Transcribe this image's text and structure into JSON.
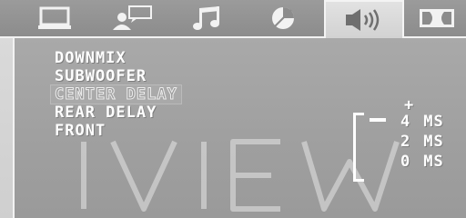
{
  "tabs": [
    {
      "id": "display",
      "icon": "monitor-icon"
    },
    {
      "id": "language",
      "icon": "person-speech-icon"
    },
    {
      "id": "audio",
      "icon": "music-notes-icon"
    },
    {
      "id": "video",
      "icon": "color-disc-icon"
    },
    {
      "id": "speaker",
      "icon": "speaker-icon",
      "active": true
    },
    {
      "id": "dolby",
      "icon": "dolby-icon"
    }
  ],
  "menu": {
    "items": [
      {
        "label": "DOWNMIX",
        "selected": false
      },
      {
        "label": "SUBWOOFER",
        "selected": false
      },
      {
        "label": "CENTER DELAY",
        "selected": true
      },
      {
        "label": "REAR DELAY",
        "selected": false
      },
      {
        "label": "FRONT",
        "selected": false
      }
    ]
  },
  "delay_scale": {
    "plus": "+",
    "values": [
      {
        "num": "4",
        "unit": "MS"
      },
      {
        "num": "2",
        "unit": "MS"
      },
      {
        "num": "0",
        "unit": "MS"
      }
    ],
    "current_level": 1.0
  },
  "watermark": {
    "text": "iVIEW"
  },
  "colors": {
    "tabbar_bg": "#8c8c8c",
    "panel_bg": "#a3a3a3",
    "text": "#ffffff",
    "selected_text": "#9a9a9a"
  }
}
